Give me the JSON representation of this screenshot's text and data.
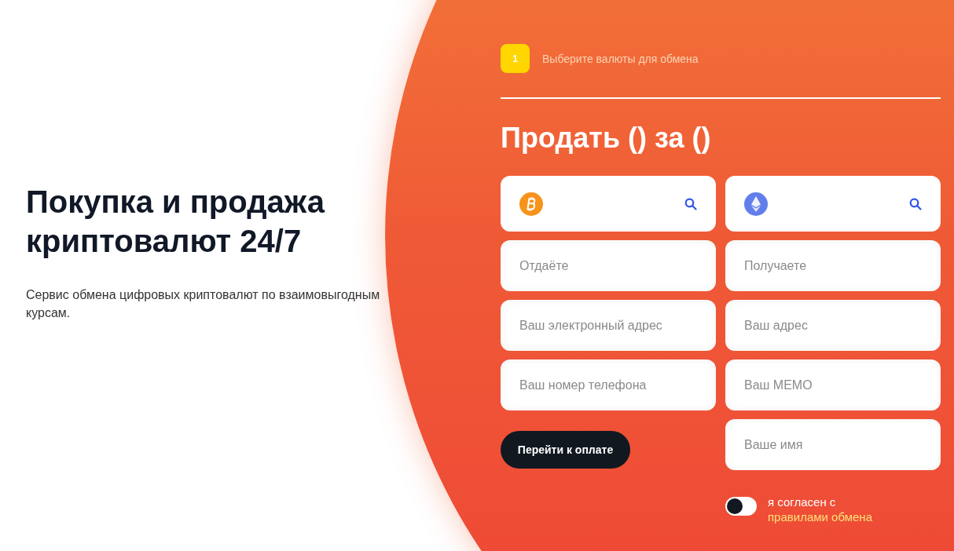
{
  "hero": {
    "title": "Покупка и продажа криптовалют 24/7",
    "subtitle": "Сервис обмена цифровых криптовалют по взаимовыгодным курсам."
  },
  "step": {
    "number": "1",
    "label": "Выберите валюты для обмена"
  },
  "form": {
    "heading": "Продать () за ()",
    "currencies": [
      {
        "kind": "bitcoin"
      },
      {
        "kind": "ethereum"
      }
    ],
    "left_fields": [
      {
        "placeholder": "Отдаёте"
      },
      {
        "placeholder": "Ваш электронный адрес"
      },
      {
        "placeholder": "Ваш номер телефона"
      }
    ],
    "right_fields": [
      {
        "placeholder": "Получаете"
      },
      {
        "placeholder": "Ваш адрес"
      },
      {
        "placeholder": "Ваш MEMO"
      },
      {
        "placeholder": "Ваше имя"
      }
    ],
    "submit": "Перейти к оплате",
    "agree": {
      "on": false,
      "text": "я согласен с",
      "link": "правилами обмена"
    }
  }
}
